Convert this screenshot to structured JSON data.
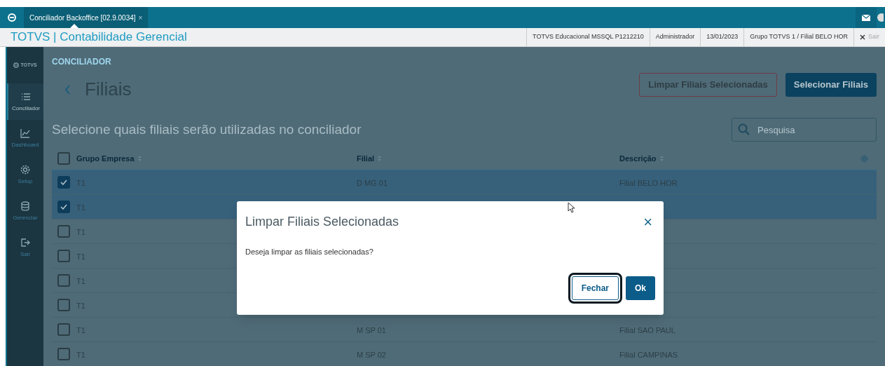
{
  "window": {
    "tab_title": "Conciliador Backoffice [02.9.0034]",
    "tab_close": "×"
  },
  "header": {
    "title": "TOTVS | Contabilidade Gerencial",
    "info": [
      "TOTVS Educacional MSSQL P1212210",
      "Administrador",
      "13/01/2023",
      "Grupo TOTVS 1 / Filial BELO HOR"
    ],
    "exit": "Sair"
  },
  "sidebar": {
    "logo": "TOTVS",
    "items": [
      {
        "label": "Conciliador",
        "selected": true
      },
      {
        "label": "Dashboard",
        "selected": false
      },
      {
        "label": "Setup",
        "selected": false
      },
      {
        "label": "Gerenciar",
        "selected": false
      },
      {
        "label": "Sair",
        "selected": false
      }
    ]
  },
  "page": {
    "breadcrumb": "CONCILIADOR",
    "title": "Filiais",
    "subtitle": "Selecione quais filiais serão utilizadas no conciliador",
    "buttons": [
      {
        "label": "Limpar Filiais Selecionadas",
        "kind": "secondary"
      },
      {
        "label": "Selecionar Filiais",
        "kind": "primary"
      }
    ],
    "search": {
      "placeholder": "Pesquisa"
    }
  },
  "table": {
    "all_checked": false,
    "columns": [
      "Grupo Empresa",
      "Filial",
      "Descrição"
    ],
    "rows": [
      {
        "checked": true,
        "cells": [
          "T1",
          "D MG 01",
          "Filial BELO HOR"
        ]
      },
      {
        "checked": true,
        "cells": [
          "T1"
        ]
      },
      {
        "checked": false,
        "cells": [
          "T1"
        ]
      },
      {
        "checked": false,
        "cells": [
          "T1"
        ]
      },
      {
        "checked": false,
        "cells": [
          "T1"
        ]
      },
      {
        "checked": false,
        "cells": [
          "T1"
        ]
      },
      {
        "checked": false,
        "cells": [
          "T1",
          "M SP 01",
          "Filial SAO PAUL"
        ]
      },
      {
        "checked": false,
        "cells": [
          "T1",
          "M SP 02",
          "Filial CAMPINAS"
        ]
      }
    ]
  },
  "dialog": {
    "title": "Limpar Filiais Selecionadas",
    "close": "×",
    "message": "Deseja limpar as filiais selecionadas?",
    "buttons": [
      {
        "label": "Fechar",
        "kind": "secondary",
        "focused": true
      },
      {
        "label": "Ok",
        "kind": "primary",
        "focused": false
      }
    ]
  }
}
